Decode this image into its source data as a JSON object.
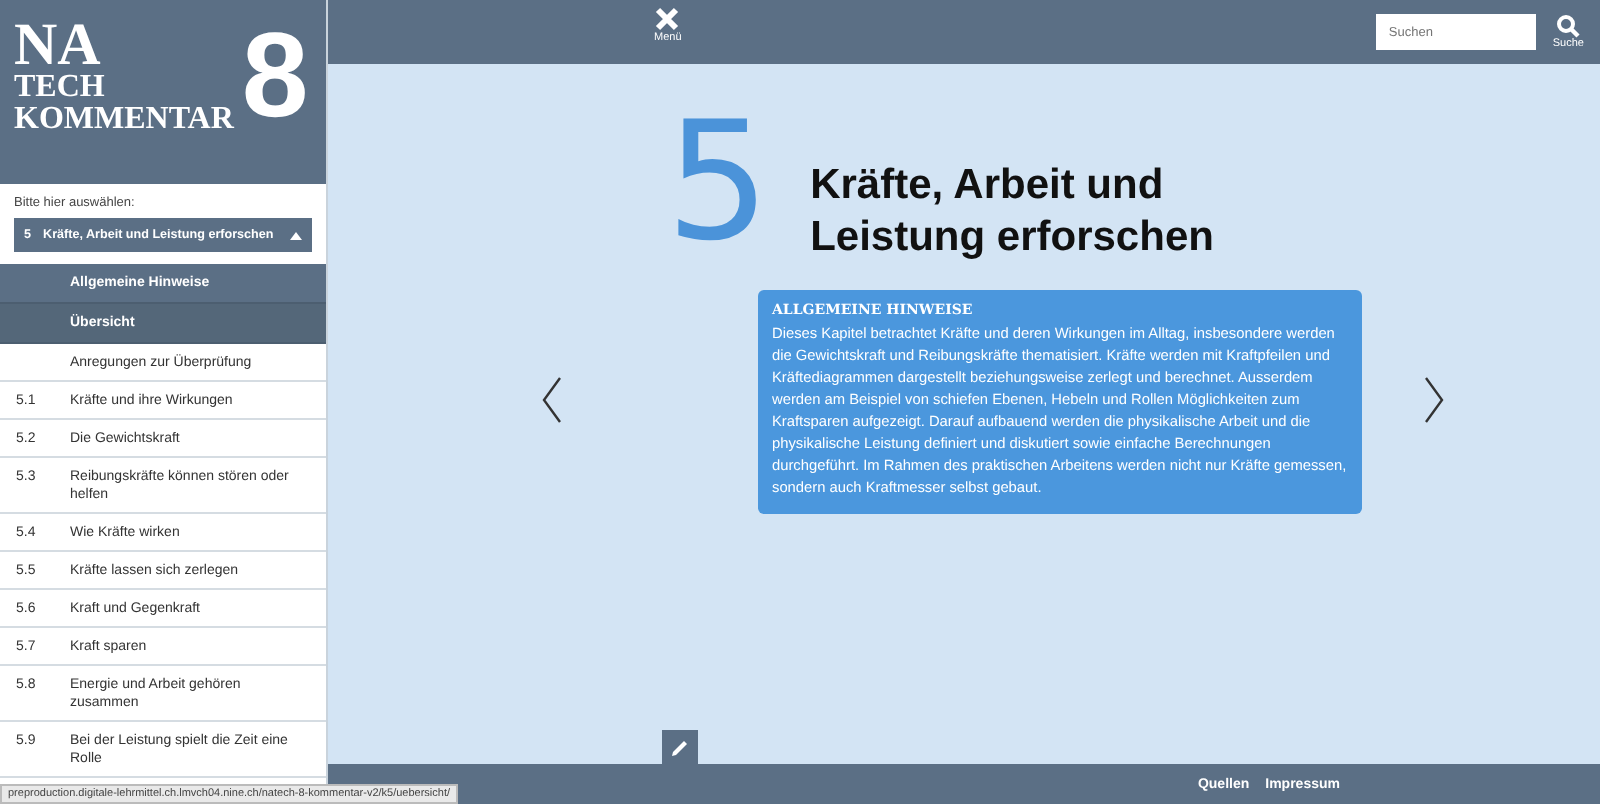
{
  "logo": {
    "lines": [
      "NA",
      "TECH",
      "KOMMENTAR"
    ],
    "number": "8"
  },
  "sidebar": {
    "prompt": "Bitte hier auswählen:",
    "dropdown": {
      "number": "5",
      "label": "Kräfte, Arbeit und Leistung erforschen",
      "expanded": true
    },
    "subitems": [
      {
        "label": "Allgemeine Hinweise",
        "selected": false
      },
      {
        "label": "Übersicht",
        "selected": true
      }
    ],
    "items": [
      {
        "label": "Anregungen zur Überprüfung"
      },
      {
        "number": "5.1",
        "label": "Kräfte und ihre Wirkungen"
      },
      {
        "number": "5.2",
        "label": "Die Gewichtskraft"
      },
      {
        "number": "5.3",
        "label": "Reibungskräfte können stören oder helfen"
      },
      {
        "number": "5.4",
        "label": "Wie Kräfte wirken"
      },
      {
        "number": "5.5",
        "label": "Kräfte lassen sich zerlegen"
      },
      {
        "number": "5.6",
        "label": "Kraft und Gegenkraft"
      },
      {
        "number": "5.7",
        "label": "Kraft sparen"
      },
      {
        "number": "5.8",
        "label": "Energie und Arbeit gehören zusammen"
      },
      {
        "number": "5.9",
        "label": "Bei der Leistung spielt die Zeit eine Rolle"
      }
    ]
  },
  "topbar": {
    "menu_label": "Menü",
    "search": {
      "placeholder": "Suchen"
    },
    "search_label": "Suche"
  },
  "chapter": {
    "number": "5",
    "title": "Kräfte, Arbeit und Leistung erforschen"
  },
  "info_box": {
    "heading": "ALLGEMEINE HINWEISE",
    "text": "Dieses Kapitel betrachtet Kräfte und deren Wirkungen im Alltag, insbesondere werden die Gewichtskraft und Reibungskräfte thematisiert. Kräfte werden mit Kraftpfeilen und Kräftediagrammen dargestellt beziehungsweise zerlegt und berechnet. Ausserdem werden am Beispiel von schiefen Ebenen, Hebeln und Rollen Möglichkeiten zum Kraftsparen aufgezeigt. Darauf aufbauend werden die physikalische Arbeit und die physikalische Leistung definiert und diskutiert sowie einfache Berechnungen durchgeführt. Im Rahmen des praktischen Arbeitens werden nicht nur Kräfte gemessen, sondern auch Kraftmesser selbst gebaut."
  },
  "footer": {
    "links": [
      "Quellen",
      "Impressum"
    ]
  },
  "status_url": "preproduction.digitale-lehrmittel.ch.lmvch04.nine.ch/natech-8-kommentar-v2/k5/uebersicht/"
}
